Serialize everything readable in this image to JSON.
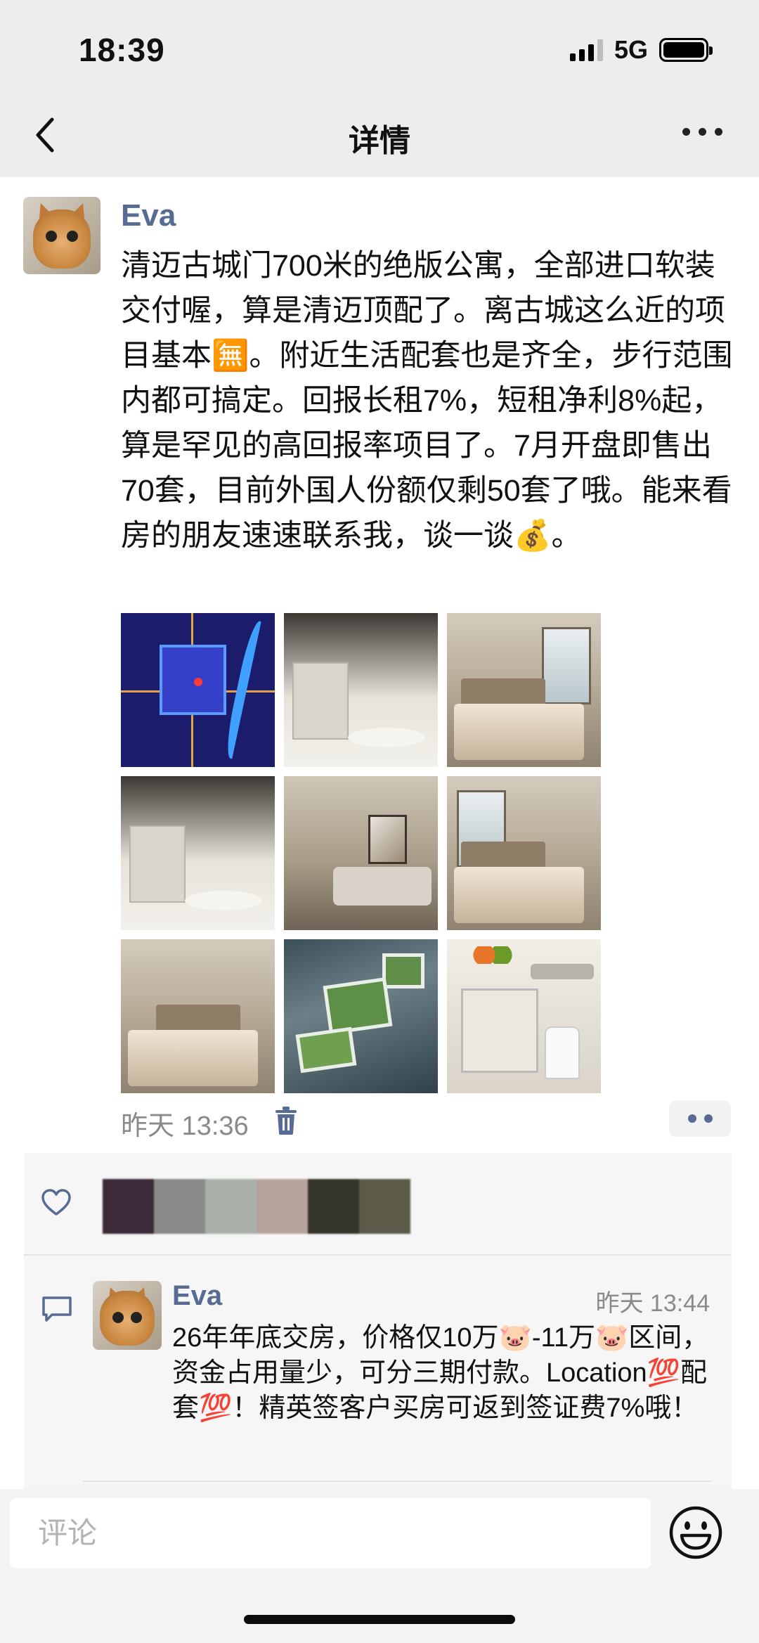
{
  "status_bar": {
    "time": "18:39",
    "network": "5G"
  },
  "nav": {
    "title": "详情"
  },
  "post": {
    "author": "Eva",
    "text": "清迈古城门700米的绝版公寓，全部进口软装交付喔，算是清迈顶配了。离古城这么近的项目基本🈚。附近生活配套也是齐全，步行范围内都可搞定。回报长租7%，短租净利8%起，算是罕见的高回报率项目了。7月开盘即售出70套，目前外国人份额仅剩50套了哦。能来看房的朋友速速联系我，谈一谈💰。",
    "time": "昨天 13:36",
    "images": [
      "map",
      "dining-living",
      "bedroom",
      "kitchen",
      "living-room",
      "bedroom-window",
      "bedroom-lamps",
      "aerial-rooftop",
      "kitchen-counter"
    ]
  },
  "comment": {
    "author": "Eva",
    "time": "昨天 13:44",
    "text": "26年年底交房，价格仅10万🐷-11万🐷区间，资金占用量少，可分三期付款。Location💯配套💯！精英签客户买房可返到签证费7%哦！"
  },
  "likers": {
    "colors": [
      "#3c2a38",
      "#888a87",
      "#a9b1aa",
      "#b6a49b",
      "#36352c",
      "#5c5b4a"
    ]
  },
  "input": {
    "placeholder": "评论"
  },
  "icons": {
    "back": "chevron-left-icon",
    "more": "more-dots-icon",
    "trash": "trash-icon",
    "like": "heart-icon",
    "comment": "comment-icon",
    "emoji": "emoji-icon"
  }
}
